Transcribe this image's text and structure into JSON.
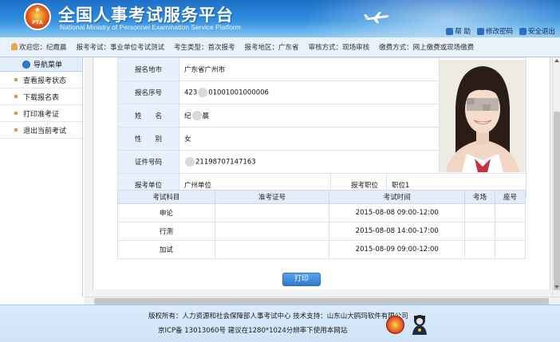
{
  "header": {
    "title": "全国人事考试服务平台",
    "subtitle": "National Ministry of Personnel Examination Service Platform",
    "logo_text": "PTA",
    "links": [
      {
        "label": "帮 助",
        "icon": "help-icon"
      },
      {
        "label": "修改密码",
        "icon": "key-icon"
      },
      {
        "label": "安全退出",
        "icon": "logout-icon"
      }
    ]
  },
  "infobar": {
    "welcome": "欢迎您：纪霞晨",
    "exam": "报考考试：事业单位考试测试",
    "exam_type": "考生类型：首次报考",
    "region": "报考地区：广东省",
    "review": "审核方式：现场审核",
    "payment": "缴费方式：网上缴费或现场缴费"
  },
  "sidebar": {
    "title": "导航菜单",
    "items": [
      {
        "label": "查看报考状态"
      },
      {
        "label": "下载报名表"
      },
      {
        "label": "打印准考证"
      },
      {
        "label": "退出当前考试"
      }
    ]
  },
  "info": {
    "rows": [
      {
        "label": "报名地市",
        "value": "广东省广州市"
      },
      {
        "label": "报名序号",
        "value_pre": "423",
        "value_post": "01001001000006"
      },
      {
        "label": "姓　　名",
        "value_pre": "纪",
        "value_post": "晨"
      },
      {
        "label": "性　　别",
        "value": "女"
      },
      {
        "label": "证件号码",
        "value_pre": "",
        "value_post": "21198707147163"
      }
    ],
    "unit_label": "报考单位",
    "unit_value": "广州单位",
    "position_label": "报考职位",
    "position_value": "职位1"
  },
  "exam_table": {
    "headers": [
      "考试科目",
      "准考证号",
      "考试时间",
      "考场",
      "座号"
    ],
    "rows": [
      {
        "subject": "申论",
        "ticket": "",
        "time": "2015-08-08 09:00-12:00",
        "room": "",
        "seat": ""
      },
      {
        "subject": "行测",
        "ticket": "",
        "time": "2015-08-08 14:00-17:00",
        "room": "",
        "seat": ""
      },
      {
        "subject": "加试",
        "ticket": "",
        "time": "2015-08-09 09:00-12:00",
        "room": "",
        "seat": ""
      }
    ]
  },
  "print_label": "打印",
  "footer": {
    "line1": "版权所有：人力资源和社会保障部人事考试中心  技术支持：山东山大鸥玛软件有限公司",
    "line2": "京ICP备 13013060号  建议在1280*1024分辨率下使用本网站"
  },
  "colors": {
    "brand_blue": "#2f78cf",
    "header_top": "#1f6fc5",
    "label_bg": "#e8f1fb",
    "sidebar_dot": "#e39a24"
  }
}
